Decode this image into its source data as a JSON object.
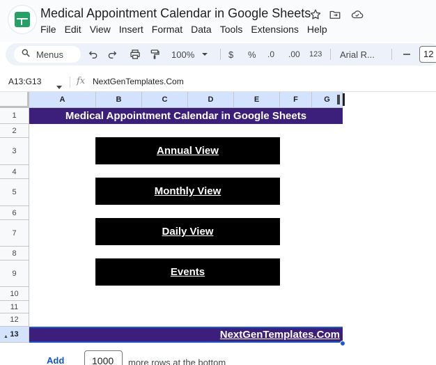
{
  "app": {
    "title": "Medical Appointment Calendar in Google Sheets",
    "menu": [
      "File",
      "Edit",
      "View",
      "Insert",
      "Format",
      "Data",
      "Tools",
      "Extensions",
      "Help"
    ]
  },
  "toolbar": {
    "search_label": "Menus",
    "zoom": "100%",
    "currency": "$",
    "percent": "%",
    "decrease_decimal": ".0",
    "increase_decimal": ".00",
    "number_format": "123",
    "font": "Arial R...",
    "font_size": "12"
  },
  "formula_bar": {
    "name_box": "A13:G13",
    "fx": "fx",
    "value": "NextGenTemplates.Com"
  },
  "grid": {
    "columns": [
      "A",
      "B",
      "C",
      "D",
      "E",
      "F",
      "G"
    ],
    "rows": [
      "1",
      "2",
      "3",
      "4",
      "5",
      "6",
      "7",
      "8",
      "9",
      "10",
      "11",
      "12",
      "13"
    ],
    "selected_row": "13"
  },
  "sheet": {
    "title": "Medical Appointment Calendar in Google Sheets",
    "buttons": [
      "Annual View",
      "Monthly View",
      "Daily View",
      "Events"
    ],
    "footer_link": "NextGenTemplates.Com"
  },
  "add_rows": {
    "button": "Add",
    "count": "1000",
    "suffix": "more rows at the bottom"
  },
  "colors": {
    "band": "#3b1f7a",
    "button_bg": "#000000",
    "header_selected": "#d3e3fd",
    "link_blue": "#0b57d0"
  },
  "icons": [
    "star-icon",
    "move-to-folder-icon",
    "cloud-status-icon",
    "search-icon",
    "undo-icon",
    "redo-icon",
    "print-icon",
    "paint-format-icon",
    "chevron-down-icon",
    "minus-icon"
  ]
}
